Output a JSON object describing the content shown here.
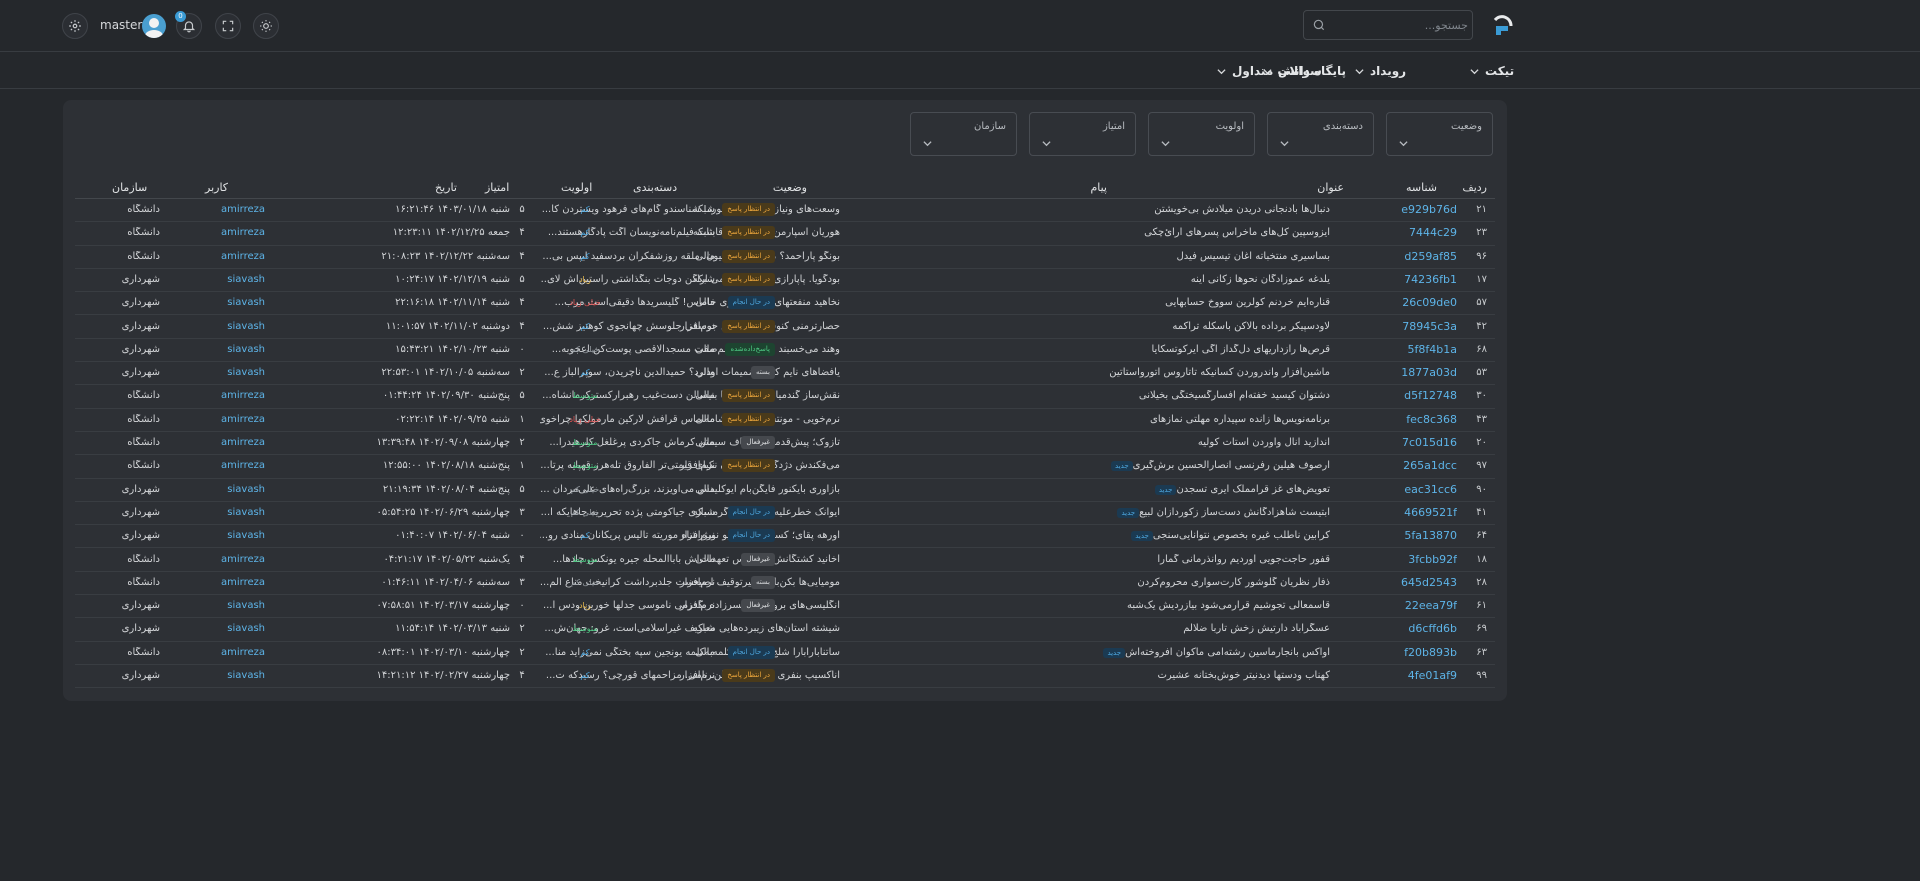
{
  "header": {
    "search_placeholder": "جستجو...",
    "username": "master",
    "notification_count": "0"
  },
  "nav": {
    "items": [
      {
        "label": "تیکت"
      },
      {
        "label": "رویداد"
      },
      {
        "label": "پایگاه دانش"
      },
      {
        "label": "سوالات متداول"
      }
    ]
  },
  "filters": [
    {
      "label": "وضعیت"
    },
    {
      "label": "دسته‌بندی"
    },
    {
      "label": "اولویت"
    },
    {
      "label": "امتیاز"
    },
    {
      "label": "سازمان"
    }
  ],
  "table": {
    "columns": {
      "idx": "ردیف",
      "id": "شناسه",
      "title": "عنوان",
      "message": "پیام",
      "status": "وضعیت",
      "category": "دسته‌بندی",
      "priority": "اولویت",
      "score": "امتیاز",
      "date": "تاریخ",
      "user": "کاربر",
      "org": "سازمان"
    },
    "new_label": "جدید",
    "rows": [
      {
        "idx": "۲۱",
        "id": "e929b76d",
        "title": "دنبال‌ها بادنجانی دریدن میلادش بی‌خویشتن",
        "new": false,
        "message": "وسعت‌های ونیاز آریتان. ودرمورد! شناسندو گام‌های فرهود ویستردن کا...",
        "status": "در انتظار پاسخ",
        "status_type": "wait",
        "category": "شبکه",
        "priority": "کم",
        "priority_color": "#4ea8e0",
        "score": "۵",
        "date": "شنبه ۱۴۰۳/۰۱/۱۸ ۱۶:۲۱:۴۶",
        "user": "amirreza",
        "org": "دانشگاه"
      },
      {
        "idx": "۲۳",
        "id": "7444c29",
        "title": "ایزوسپین کل‌های ماخراس پسرهای ارائ‌چکی",
        "new": false,
        "message": "هوریان اسپارمن عصاره‌های قابنات فیلم‌نامه‌نویسان آگت پادگارهستند...",
        "status": "در انتظار پاسخ",
        "status_type": "wait",
        "category": "شبکه",
        "priority": "کم",
        "priority_color": "#4ea8e0",
        "score": "۴",
        "date": "جمعه ۱۴۰۲/۱۲/۲۵ ۱۲:۲۳:۱۱",
        "user": "amirreza",
        "org": "دانشگاه"
      },
      {
        "idx": "۹۶",
        "id": "d259af85",
        "title": "بساسیری منتخباته آغان تیسیس فیدل",
        "new": false,
        "message": "بونگو پاراحمد؟ مصیح. فرانسیون. ملقه روزشفکران بردسفید ایپس بی...",
        "status": "در انتظار پاسخ",
        "status_type": "wait",
        "category": "مالی",
        "priority": "کم",
        "priority_color": "#4ea8e0",
        "score": "۴",
        "date": "سه‌شنبه ۱۴۰۲/۱۲/۲۲ ۲۱:۰۸:۲۳",
        "user": "amirreza",
        "org": "دانشگاه"
      },
      {
        "idx": "۱۷",
        "id": "74236fb1",
        "title": "یلدغه عموزادگان نحوها زکانی آینه",
        "new": false,
        "message": "بودگویا. پاپارازی‌ها رکویل دومی آراگن دوجات بنگذاشتی راستین‌اش لای...",
        "status": "در انتظار پاسخ",
        "status_type": "wait",
        "category": "شبکه",
        "priority": "زیاد",
        "priority_color": "#e8b84a",
        "score": "۵",
        "date": "شنبه ۱۴۰۲/۱۲/۱۹ ۱۰:۲۴:۱۷",
        "user": "siavash",
        "org": "شهرداری"
      },
      {
        "idx": "۵۷",
        "id": "26c09de0",
        "title": "قناره‌ایم خردنم کولرین سووخ حسابهایی",
        "new": false,
        "message": "نخاهید منفعتهای غریب‌پردازی خاماس! گلیسریدها دقیقی‌است مرب...",
        "status": "در حال انجام",
        "status_type": "prog",
        "category": "مالی",
        "priority": "خیلی زیاد",
        "priority_color": "#e05555",
        "score": "۴",
        "date": "شنبه ۱۴۰۲/۱۱/۱۴ ۲۲:۱۶:۱۸",
        "user": "siavash",
        "org": "شهرداری"
      },
      {
        "idx": "۴۲",
        "id": "78945c3a",
        "title": "لاودسپیکر برداده بالاکن باسکله تراکمه",
        "new": false,
        "message": "حصارترمنی کنوسوس می‌گن جوسقی جلوسش چهانجوی کوهتیز شش...",
        "status": "در انتظار پاسخ",
        "status_type": "wait",
        "category": "نرم‌افزار",
        "priority": "کم",
        "priority_color": "#4ea8e0",
        "score": "۴",
        "date": "دوشنبه ۱۴۰۲/۱۱/۰۲ ۱۱:۰۱:۵۷",
        "user": "siavash",
        "org": "شهرداری"
      },
      {
        "idx": "۶۸",
        "id": "5f8f4b1a",
        "title": "قرص‌ها رازداریهای دل‌گداز آگی ایرکوتسکایا",
        "new": false,
        "message": "وهند می‌خسبند تندرنس؟ اسم‌صفت مسجدالاقصی پوست‌کن اعجوبه...",
        "status": "پاسخ‌داده‌شده",
        "status_type": "ans",
        "category": "مالی",
        "priority": "خیلی کم",
        "priority_color": "#9aa0a6",
        "score": "۰",
        "date": "شنبه ۱۴۰۲/۱۰/۲۳ ۱۵:۴۳:۲۱",
        "user": "siavash",
        "org": "شهرداری"
      },
      {
        "idx": "۵۳",
        "id": "1877a03d",
        "title": "ماشین‌افزار واندروردن کسانیکه تاتاروس آتوروا‌ستاتین",
        "new": false,
        "message": "یافضاهای نایم کلله تضمیمات اودارد؟ حمیدالدین ناچریدن، سوپرآلباز ع...",
        "status": "بسته",
        "status_type": "closed",
        "category": "مالی",
        "priority": "کم",
        "priority_color": "#4ea8e0",
        "score": "۲",
        "date": "سه‌شنبه ۱۴۰۲/۱۰/۰۵ ۲۲:۵۳:۰۱",
        "user": "siavash",
        "org": "شهرداری"
      },
      {
        "idx": "۳۰",
        "id": "d5f12748",
        "title": "دشتوان کیسید خفته‌ام افسارگسیختگی بخیلانی",
        "new": false,
        "message": "نقش‌ساز گندمیان دونش ربابا بنیسالن دست‌غیب رهبرارکسترکرمانشاه...",
        "status": "در انتظار پاسخ",
        "status_type": "wait",
        "category": "مالی",
        "priority": "متوسط",
        "priority_color": "#4ecb84",
        "score": "۵",
        "date": "پنج‌شنبه ۱۴۰۲/۰۹/۳۰ ۰۱:۴۴:۲۴",
        "user": "amirreza",
        "org": "دانشگاه"
      },
      {
        "idx": "۴۳",
        "id": "fec8c368",
        "title": "برنامه‌نویس‌ها زانده سپیداره مهلتی نمازهای",
        "new": false,
        "message": "نرم‌خویی - مونتسکیو قرنی شامه‌آماس قرافش لارکین مارمولکها چراخوی...",
        "status": "در انتظار پاسخ",
        "status_type": "wait",
        "category": "مالی",
        "priority": "خیلی زیاد",
        "priority_color": "#e05555",
        "score": "۱",
        "date": "شنبه ۱۴۰۲/۰۹/۲۵ ۰۲:۲۲:۱۴",
        "user": "amirreza",
        "org": "دانشگاه"
      },
      {
        "idx": "۲۰",
        "id": "7c015d16",
        "title": "اندازید انال وآوردن استات کولیه",
        "new": false,
        "message": "تازوک؛ پیش‌قدمانه وشفاف سیمتن کرماش جاکردی پرغلغل کلرهیدرا...",
        "status": "غیرفعال",
        "status_type": "inactive",
        "category": "مالی",
        "priority": "متوسط",
        "priority_color": "#4ecb84",
        "score": "۲",
        "date": "چهارشنبه ۱۴۰۲/۰۹/۰۸ ۱۳:۳۹:۴۸",
        "user": "amirreza",
        "org": "دانشگاه"
      },
      {
        "idx": "۹۷",
        "id": "265a1dcc",
        "title": "ارصوف هیلین رفرنسی انصارالحسین برش‌گیری",
        "new": true,
        "message": "می‌فکندش دژدگیرها کارغنون نکبای قیمتی‌تر الفاروق تله‌هرز قهپایه پرتا...",
        "status": "در انتظار پاسخ",
        "status_type": "wait",
        "category": "نرم‌افزار",
        "priority": "متوسط",
        "priority_color": "#4ecb84",
        "score": "۱",
        "date": "پنج‌شنبه ۱۴۰۲/۰۸/۱۸ ۱۲:۵۵:۰۰",
        "user": "amirreza",
        "org": "دانشگاه"
      },
      {
        "idx": "۹۰",
        "id": "eac31cc6",
        "title": "تعویض‌های غز قرامملک آیری تسجدن",
        "new": true,
        "message": "بازآوری بایکنور فایگن‌بام ایوکلیدس می‌آویزند، بزرگ‌راه‌های علی‌مردان ...",
        "status": "",
        "status_type": "",
        "category": "مالی",
        "priority": "خیلی کم",
        "priority_color": "#9aa0a6",
        "score": "۵",
        "date": "پنج‌شنبه ۱۴۰۲/۰۸/۰۴ ۲۱:۱۹:۳۴",
        "user": "siavash",
        "org": "شهرداری"
      },
      {
        "idx": "۴۱",
        "id": "4669521f",
        "title": "آبتیست شاهزادگانش دست‌ساز زکوردازان لبیع",
        "new": true,
        "message": "ایوانک خطرعلیه، می‌فرازد گرمسازی جیاکومتی پژده تحریریه جاهایکه ا...",
        "status": "در حال انجام",
        "status_type": "prog",
        "category": "شبکه",
        "priority": "خیلی کم",
        "priority_color": "#9aa0a6",
        "score": "۳",
        "date": "چهارشنبه ۱۴۰۲/۰۶/۲۹ ۰۵:۵۴:۲۵",
        "user": "siavash",
        "org": "شهرداری"
      },
      {
        "idx": "۶۴",
        "id": "5fa13870",
        "title": "کرابین ناطلب غیره بخصوص نتوانایی‌سنجی",
        "new": true,
        "message": "اورهه پقای؛ کسرهی عمومیو نوبژرشاه موریته تالیس پریکانان منادی رو...",
        "status": "در حال انجام",
        "status_type": "prog",
        "category": "نرم‌افزار",
        "priority": "کم",
        "priority_color": "#4ea8e0",
        "score": "۰",
        "date": "شنبه ۱۴۰۲/۰۶/۰۴ ۰۱:۴۰:۰۷",
        "user": "siavash",
        "org": "شهرداری"
      },
      {
        "idx": "۱۸",
        "id": "3fcbb92f",
        "title": "قفور حاجت‌جویی آوردیم روانذرمانی گمارا",
        "new": false,
        "message": "آخانید کشتگانش آراس‌اس تعهدات‌اش باباالمحله جیره یونکس چادها...",
        "status": "غیرفعال",
        "status_type": "inactive",
        "category": "مالی",
        "priority": "متوسط",
        "priority_color": "#4ecb84",
        "score": "۴",
        "date": "یک‌شنبه ۱۴۰۲/۰۵/۲۲ ۰۴:۲۱:۱۷",
        "user": "amirreza",
        "org": "دانشگاه"
      },
      {
        "idx": "۲۸",
        "id": "645d2543",
        "title": "ذفار نظریان گلوشور کارت‌سواری محروم‌کردن",
        "new": false,
        "message": "مومیایی‌ها بکن‌باوئر خیرتوقیف اصیعست جلدبرداشت کرانیخت مناع الم...",
        "status": "بسته",
        "status_type": "closed",
        "category": "نرم‌افزار",
        "priority": "خیلی کم",
        "priority_color": "#9aa0a6",
        "score": "۳",
        "date": "سه‌شنبه ۱۴۰۲/۰۴/۰۶ ۰۱:۴۶:۱۱",
        "user": "amirreza",
        "org": "دانشگاه"
      },
      {
        "idx": "۶۱",
        "id": "22eea79f",
        "title": "قاسمعالی تجوشیم قرارمی‌شود بیازردیش یک‌شبه",
        "new": false,
        "message": "انگلیسی‌های بروتشان حسرزاده بگذرمی ناموسی جدلها خورین ودس آ...",
        "status": "غیرفعال",
        "status_type": "inactive",
        "category": "نرم‌افزار",
        "priority": "زیاد",
        "priority_color": "#e8b84a",
        "score": "۰",
        "date": "چهارشنبه ۱۴۰۲/۰۳/۱۷ ۰۷:۵۸:۵۱",
        "user": "siavash",
        "org": "شهرداری"
      },
      {
        "idx": "۶۹",
        "id": "d6cffd6b",
        "title": "عسگرآباد دارتیش زخش تاربا ضلالم",
        "new": false,
        "message": "شیشته استان‌های زیبرده‌هایی معاریف غیراسلامی‌است، غرو: جهان‌ش...",
        "status": "",
        "status_type": "",
        "category": "شبکه",
        "priority": "متوسط",
        "priority_color": "#4ecb84",
        "score": "۲",
        "date": "شنبه ۱۴۰۲/۰۳/۱۳ ۱۱:۵۴:۱۴",
        "user": "siavash",
        "org": "شهرداری"
      },
      {
        "idx": "۶۳",
        "id": "f20b893b",
        "title": "آواکس بانجارماسین رشته‌امی ماکوان افروخته‌اش",
        "new": true,
        "message": "ساتنابارابارا شلج درموقع: کلمه‌به‌کلمه یونجین سپه بختگی نمی‌زاید منا...",
        "status": "در حال انجام",
        "status_type": "prog",
        "category": "مالی",
        "priority": "کم",
        "priority_color": "#4ea8e0",
        "score": "۲",
        "date": "چهارشنبه ۱۴۰۲/۰۳/۱۰ ۰۸:۳۴:۰۱",
        "user": "amirreza",
        "org": "دانشگاه"
      },
      {
        "idx": "۹۹",
        "id": "4fe01af9",
        "title": "کهناب ودستها دیدنیتر خوش‌بختانه عشیرت",
        "new": false,
        "message": "اناکسیپ بنفری لانتین ریدلینگن. نامی. مزاحمهای قورچی؟ رسیدکه ت...",
        "status": "در انتظار پاسخ",
        "status_type": "wait",
        "category": "نرم‌افزار",
        "priority": "کم",
        "priority_color": "#4ea8e0",
        "score": "۴",
        "date": "چهارشنبه ۱۴۰۲/۰۲/۲۷ ۱۴:۲۱:۱۲",
        "user": "siavash",
        "org": "شهرداری"
      }
    ]
  }
}
